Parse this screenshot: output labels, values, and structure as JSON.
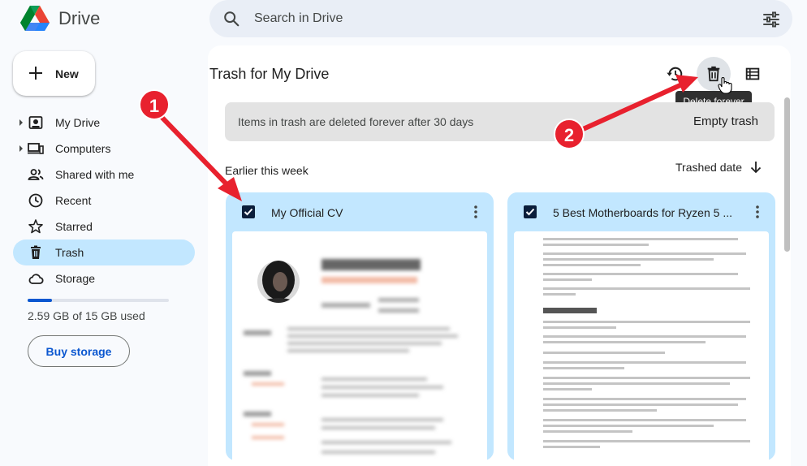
{
  "app": {
    "title": "Drive"
  },
  "search": {
    "placeholder": "Search in Drive"
  },
  "sidebar": {
    "new_label": "New",
    "items": [
      {
        "label": "My Drive",
        "icon": "my-drive-icon",
        "expandable": true,
        "active": false
      },
      {
        "label": "Computers",
        "icon": "computers-icon",
        "expandable": true,
        "active": false
      },
      {
        "label": "Shared with me",
        "icon": "people-icon",
        "expandable": false,
        "active": false
      },
      {
        "label": "Recent",
        "icon": "clock-icon",
        "expandable": false,
        "active": false
      },
      {
        "label": "Starred",
        "icon": "star-icon",
        "expandable": false,
        "active": false
      },
      {
        "label": "Trash",
        "icon": "trash-icon",
        "expandable": false,
        "active": true
      },
      {
        "label": "Storage",
        "icon": "cloud-icon",
        "expandable": false,
        "active": false
      }
    ],
    "storage_used_fraction": 0.17,
    "storage_text": "2.59 GB of 15 GB used",
    "buy_storage_label": "Buy storage"
  },
  "main": {
    "title": "Trash for My Drive",
    "toolbar": {
      "restore_icon": "restore-icon",
      "delete_icon": "trash-icon",
      "view_icon": "list-view-icon",
      "tooltip": "Delete forever"
    },
    "banner": {
      "text": "Items in trash are deleted forever after 30 days",
      "action": "Empty trash"
    },
    "section_title": "Earlier this week",
    "sort_label": "Trashed date",
    "cards": [
      {
        "title": "My Official CV",
        "checked": true
      },
      {
        "title": "5 Best Motherboards for Ryzen 5 ...",
        "checked": true
      }
    ]
  },
  "annotations": {
    "badge_1": "1",
    "badge_2": "2",
    "color": "#e8212e"
  },
  "colors": {
    "selected": "#c2e7ff",
    "accent": "#0b57d0",
    "background": "#f8fafd",
    "search_bg": "#e9eef6"
  }
}
